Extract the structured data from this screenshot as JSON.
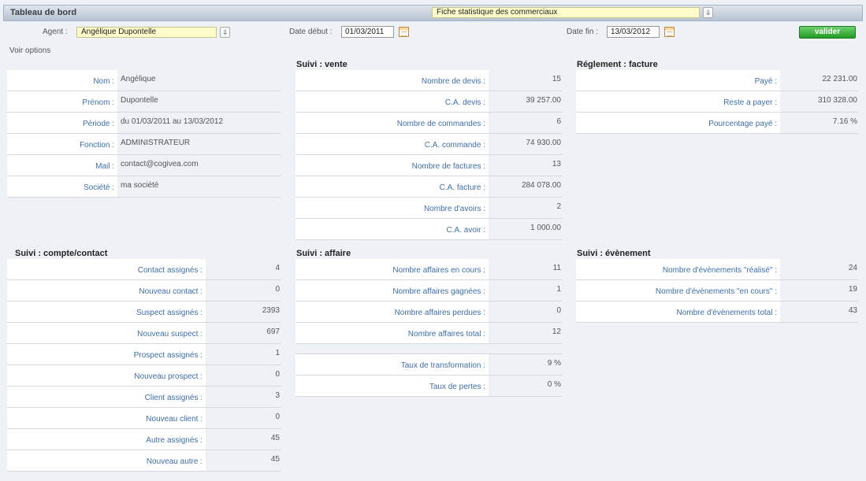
{
  "header": {
    "title": "Tableau de bord",
    "report_select": "Fiche statistique des commerciaux"
  },
  "filters": {
    "agent_label": "Agent :",
    "agent_value": "Angélique Dupontelle",
    "date_debut_label": "Date début :",
    "date_debut_value": "01/03/2011",
    "date_fin_label": "Date fin :",
    "date_fin_value": "13/03/2012",
    "valider_label": "valider"
  },
  "voir_options": "Voir options",
  "profile": {
    "rows": [
      {
        "label": "Nom :",
        "value": "Angélique"
      },
      {
        "label": "Prénom :",
        "value": "Dupontelle"
      },
      {
        "label": "Période :",
        "value": "du 01/03/2011 au 13/03/2012"
      },
      {
        "label": "Fonction :",
        "value": "ADMINISTRATEUR"
      },
      {
        "label": "Mail :",
        "value": "contact@cogivea.com"
      },
      {
        "label": "Société :",
        "value": "ma société"
      }
    ]
  },
  "suivi_vente": {
    "title": "Suivi : vente",
    "rows": [
      {
        "label": "Nombre de devis :",
        "value": "15"
      },
      {
        "label": "C.A. devis :",
        "value": "39 257.00"
      },
      {
        "label": "Nombre de commandes :",
        "value": "6"
      },
      {
        "label": "C.A. commande :",
        "value": "74 930.00"
      },
      {
        "label": "Nombre de factures :",
        "value": "13"
      },
      {
        "label": "C.A. facture :",
        "value": "284 078.00"
      },
      {
        "label": "Nombre d'avoirs :",
        "value": "2"
      },
      {
        "label": "C.A. avoir :",
        "value": "1 000.00"
      }
    ]
  },
  "reglement_facture": {
    "title": "Réglement : facture",
    "rows": [
      {
        "label": "Payé :",
        "value": "22 231.00"
      },
      {
        "label": "Reste a payer :",
        "value": "310 328.00"
      },
      {
        "label": "Pourcentage payé :",
        "value": "7.16 %"
      }
    ]
  },
  "suivi_compte_contact": {
    "title": "Suivi : compte/contact",
    "rows": [
      {
        "label": "Contact assignés :",
        "value": "4"
      },
      {
        "label": "Nouveau contact :",
        "value": "0"
      },
      {
        "label": "Suspect assignés :",
        "value": "2393"
      },
      {
        "label": "Nouveau suspect :",
        "value": "697"
      },
      {
        "label": "Prospect assignés :",
        "value": "1"
      },
      {
        "label": "Nouveau prospect :",
        "value": "0"
      },
      {
        "label": "Client assignés :",
        "value": "3"
      },
      {
        "label": "Nouveau client :",
        "value": "0"
      },
      {
        "label": "Autre assignés :",
        "value": "45"
      },
      {
        "label": "Nouveau autre :",
        "value": "45"
      }
    ]
  },
  "suivi_affaire": {
    "title": "Suivi : affaire",
    "rows": [
      {
        "label": "Nombre affaires en cours :",
        "value": "11"
      },
      {
        "label": "Nombre affaires gagnées :",
        "value": "1"
      },
      {
        "label": "Nombre affaires perdues :",
        "value": "0"
      },
      {
        "label": "Nombre affaires total :",
        "value": "12"
      }
    ],
    "rates": [
      {
        "label": "Taux de transformation :",
        "value": "9 %"
      },
      {
        "label": "Taux de pertes :",
        "value": "0 %"
      }
    ]
  },
  "suivi_evenement": {
    "title": "Suivi : évènement",
    "rows": [
      {
        "label": "Nombre d'évènements \"réalisé\" :",
        "value": "24"
      },
      {
        "label": "Nombre d'évènements \"en cours\" :",
        "value": "19"
      },
      {
        "label": "Nombre d'évènements total :",
        "value": "43"
      }
    ]
  }
}
